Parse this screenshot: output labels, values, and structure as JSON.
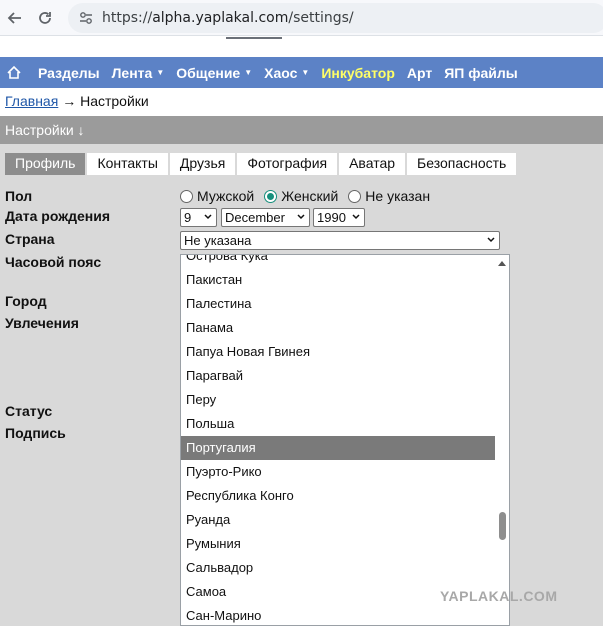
{
  "browser": {
    "url_scheme": "https://",
    "url_host": "alpha.yaplakal.com",
    "url_path": "/settings/"
  },
  "site_nav": {
    "home_icon": "home-icon",
    "items": [
      {
        "label": "Разделы",
        "dropdown": false
      },
      {
        "label": "Лента",
        "dropdown": true
      },
      {
        "label": "Общение",
        "dropdown": true
      },
      {
        "label": "Хаос",
        "dropdown": true
      },
      {
        "label": "Инкубатор",
        "dropdown": false,
        "accent": true
      },
      {
        "label": "Арт",
        "dropdown": false
      },
      {
        "label": "ЯП файлы",
        "dropdown": false
      }
    ],
    "colors": {
      "background": "#5c82c6",
      "accent": "#ffff66"
    }
  },
  "breadcrumb": {
    "home": "Главная",
    "separator": "→",
    "current": "Настройки"
  },
  "section_title": "Настройки ↓",
  "tabs": [
    {
      "label": "Профиль",
      "active": true
    },
    {
      "label": "Контакты",
      "active": false
    },
    {
      "label": "Друзья",
      "active": false
    },
    {
      "label": "Фотография",
      "active": false
    },
    {
      "label": "Аватар",
      "active": false
    },
    {
      "label": "Безопасность",
      "active": false
    }
  ],
  "form": {
    "labels": {
      "gender": "Пол",
      "birthdate": "Дата рождения",
      "country": "Страна",
      "timezone": "Часовой пояс",
      "city": "Город",
      "interests": "Увлечения",
      "status": "Статус",
      "signature": "Подпись"
    },
    "gender_options": [
      {
        "label": "Мужской",
        "checked": false
      },
      {
        "label": "Женский",
        "checked": true
      },
      {
        "label": "Не указан",
        "checked": false
      }
    ],
    "birth_day": "9",
    "birth_month": "December",
    "birth_year": "1990",
    "country_value": "Не указана"
  },
  "country_list": {
    "options": [
      "Острова Кука",
      "Пакистан",
      "Палестина",
      "Панама",
      "Папуа Новая Гвинея",
      "Парагвай",
      "Перу",
      "Польша",
      "Португалия",
      "Пуэрто-Рико",
      "Республика Конго",
      "Руанда",
      "Румыния",
      "Сальвадор",
      "Самоа",
      "Сан-Марино"
    ],
    "highlighted": "Португалия"
  },
  "watermark": "YAPLAKAL.COM"
}
